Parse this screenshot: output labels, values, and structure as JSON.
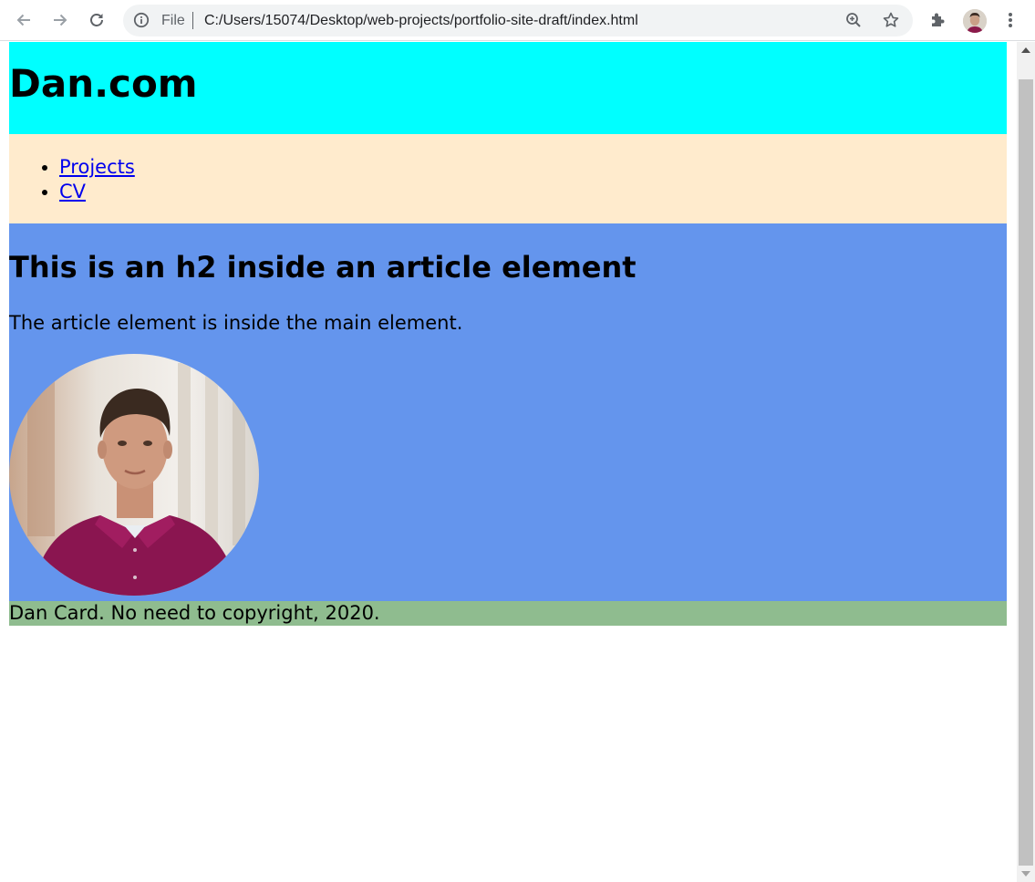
{
  "browser": {
    "scheme_label": "File",
    "url": "C:/Users/15074/Desktop/web-projects/portfolio-site-draft/index.html",
    "icons": [
      "back-arrow-icon",
      "forward-arrow-icon",
      "reload-icon",
      "info-icon",
      "zoom-icon",
      "star-icon",
      "extensions-icon",
      "profile-avatar",
      "menu-icon"
    ]
  },
  "page": {
    "header": {
      "title": "Dan.com",
      "background": "#00ffff"
    },
    "nav": {
      "background": "#ffebcd",
      "links": [
        {
          "label": "Projects"
        },
        {
          "label": "CV"
        }
      ]
    },
    "article": {
      "background": "#6495ed",
      "heading": "This is an h2 inside an article element",
      "paragraph": "The article element is inside the main element.",
      "photo": "circular-portrait-photo"
    },
    "footer": {
      "background": "#8fbc8f",
      "text": "Dan Card. No need to copyright, 2020."
    }
  }
}
